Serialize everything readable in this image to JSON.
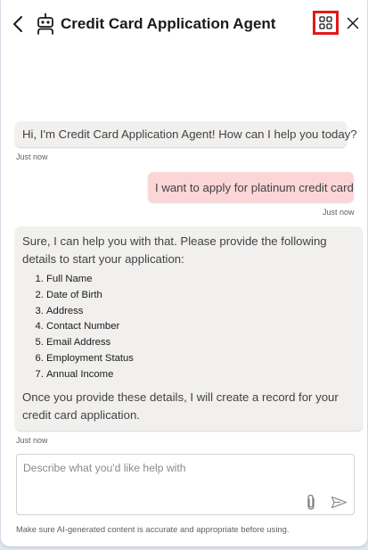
{
  "header": {
    "title": "Credit Card Application Agent",
    "back_icon": "chevron-left-icon",
    "agent_icon": "bot-icon",
    "apps_icon": "apps-grid-icon",
    "close_icon": "close-icon"
  },
  "messages": [
    {
      "role": "bot",
      "text": "Hi, I'm Credit Card Application Agent! How can I help you today?",
      "timestamp": "Just now"
    },
    {
      "role": "user",
      "text": "I want to apply for platinum credit card",
      "timestamp": "Just now"
    },
    {
      "role": "bot",
      "intro": "Sure, I can help you with that. Please provide the following details to start your application:",
      "list": [
        "Full Name",
        "Date of Birth",
        "Address",
        "Contact Number",
        "Email Address",
        "Employment Status",
        "Annual Income"
      ],
      "outro": "Once you provide these details, I will create a record for your credit card application.",
      "timestamp": "Just now"
    }
  ],
  "composer": {
    "placeholder": "Describe what you'd like help with",
    "value": "",
    "attach_icon": "paperclip-icon",
    "send_icon": "send-icon"
  },
  "footer": {
    "disclaimer": "Make sure AI-generated content is accurate and appropriate before using."
  },
  "colors": {
    "bot_bubble": "#f1f0ef",
    "user_bubble": "#fcd6d6",
    "highlight_border": "#e01a1a",
    "title_text": "#1a1a1a"
  }
}
